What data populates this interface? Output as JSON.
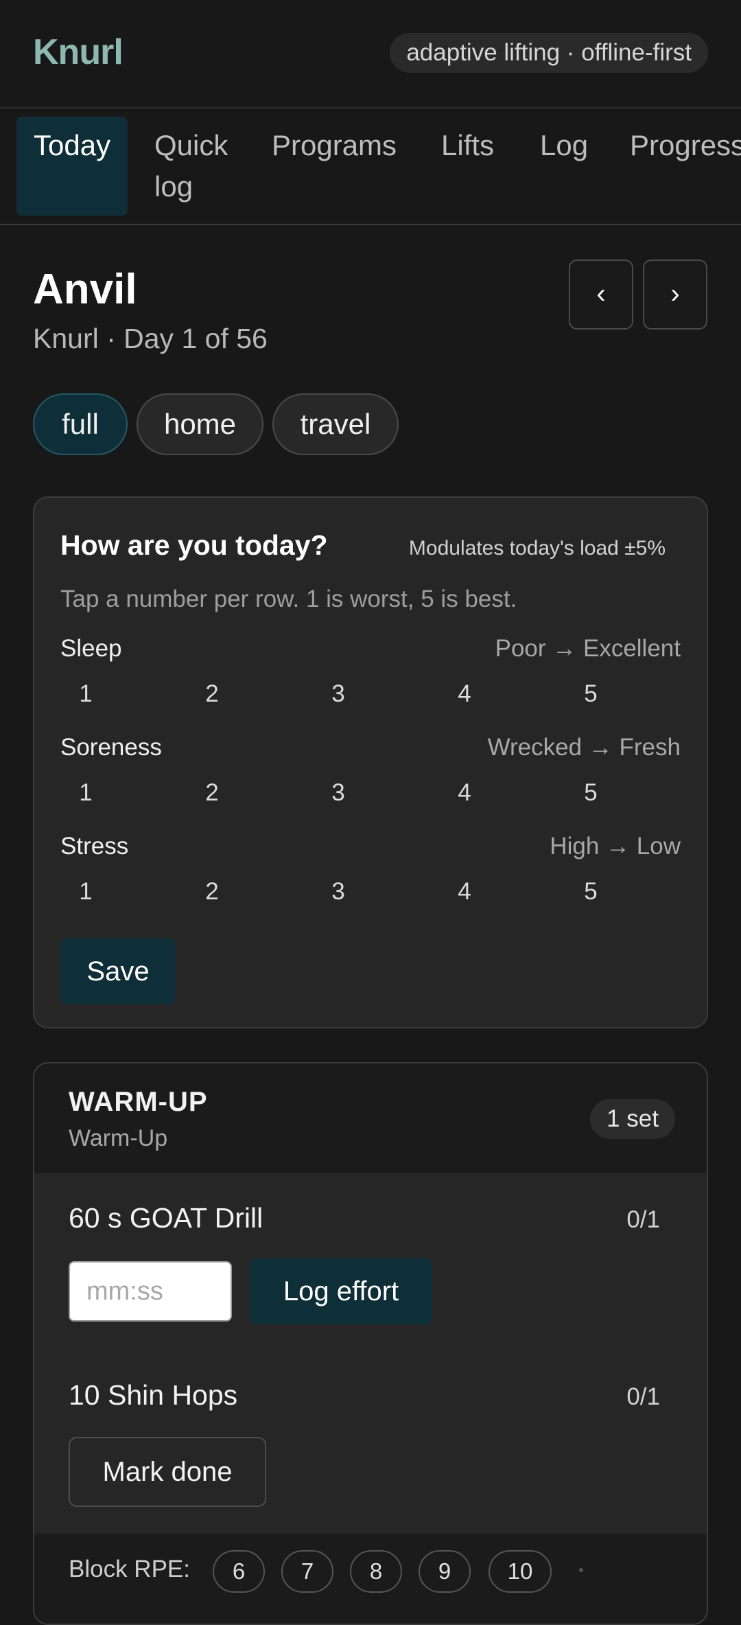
{
  "header": {
    "logo": "Knurl",
    "tagline": "adaptive lifting · offline-first"
  },
  "tabs": [
    {
      "line1": "Today",
      "line2": ""
    },
    {
      "line1": "Quick",
      "line2": "log"
    },
    {
      "line1": "Programs",
      "line2": ""
    },
    {
      "line1": "Lifts",
      "line2": ""
    },
    {
      "line1": "Log",
      "line2": ""
    },
    {
      "line1": "Progress",
      "line2": ""
    }
  ],
  "active_tab": "Today",
  "day": {
    "title": "Anvil",
    "subtitle": "Knurl · Day 1 of 56",
    "prev_icon": "‹",
    "next_icon": "›"
  },
  "modes": [
    "full",
    "home",
    "travel"
  ],
  "active_mode": "full",
  "checkin": {
    "title": "How are you today?",
    "note": "Modulates today's load ±5%",
    "hint": "Tap a number per row. 1 is worst, 5 is best.",
    "rows": [
      {
        "label": "Sleep",
        "range": "Poor → Excellent"
      },
      {
        "label": "Soreness",
        "range": "Wrecked → Fresh"
      },
      {
        "label": "Stress",
        "range": "High → Low"
      }
    ],
    "scale": [
      "1",
      "2",
      "3",
      "4",
      "5"
    ],
    "save_label": "Save"
  },
  "block": {
    "name": "WARM-UP",
    "sub": "Warm-Up",
    "badge": "1 set",
    "exercises": [
      {
        "name": "60 s GOAT Drill",
        "count": "0/1",
        "input_placeholder": "mm:ss",
        "action": "Log effort"
      },
      {
        "name": "10 Shin Hops",
        "count": "0/1",
        "action": "Mark done"
      }
    ],
    "rpe_label": "Block RPE:",
    "rpe_options": [
      "6",
      "7",
      "8",
      "9",
      "10"
    ]
  },
  "colors": {
    "accent": "#0f2f38",
    "logo": "#8fb8ad",
    "background": "#181818",
    "card": "#262626"
  }
}
